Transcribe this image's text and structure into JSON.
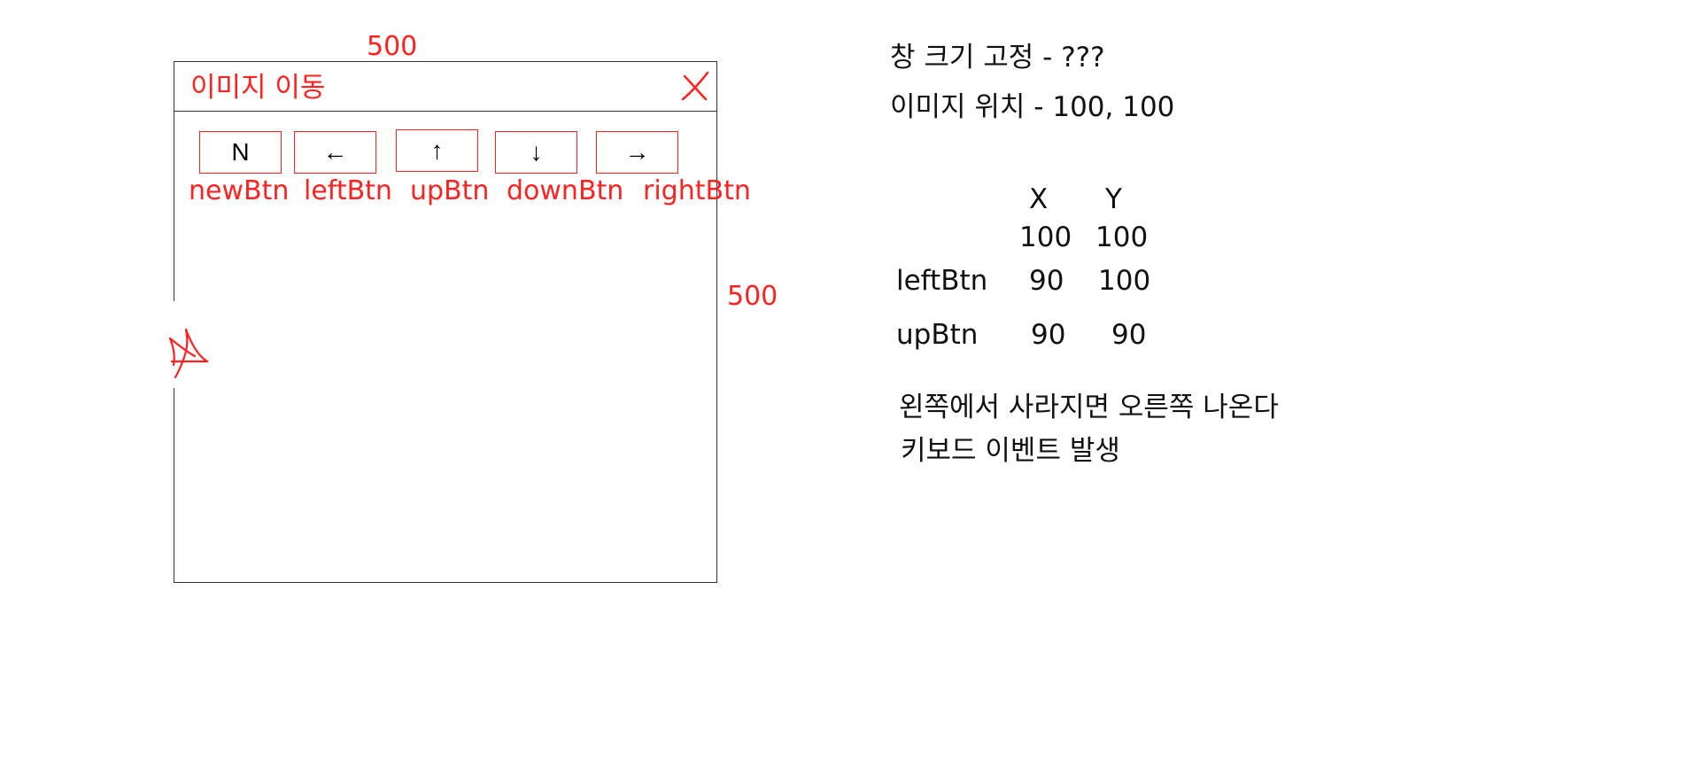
{
  "dimensions": {
    "width_label": "500",
    "height_label": "500"
  },
  "window": {
    "title": "이미지 이동",
    "close_icon": "close-icon"
  },
  "buttons": [
    {
      "glyph": "N",
      "caption": "newBtn"
    },
    {
      "glyph": "←",
      "caption": "leftBtn"
    },
    {
      "glyph": "↑",
      "caption": "upBtn"
    },
    {
      "glyph": "↓",
      "caption": "downBtn"
    },
    {
      "glyph": "→",
      "caption": "rightBtn"
    }
  ],
  "image_icon": "star-icon",
  "notes": {
    "fixed_size": "창 크기 고정 - ???",
    "image_position": "이미지 위치 - 100, 100",
    "wrap_rule": "왼쪽에서 사라지면 오른쪽 나온다",
    "keyboard": "키보드 이벤트 발생"
  },
  "coord_table": {
    "headers": [
      "X",
      "Y"
    ],
    "rows": [
      {
        "label": "",
        "x": "100",
        "y": "100"
      },
      {
        "label": "leftBtn",
        "x": "90",
        "y": "100"
      },
      {
        "label": "upBtn",
        "x": "90",
        "y": "90"
      }
    ]
  },
  "colors": {
    "annotation_red": "#ff2020",
    "ink_black": "#111111"
  }
}
